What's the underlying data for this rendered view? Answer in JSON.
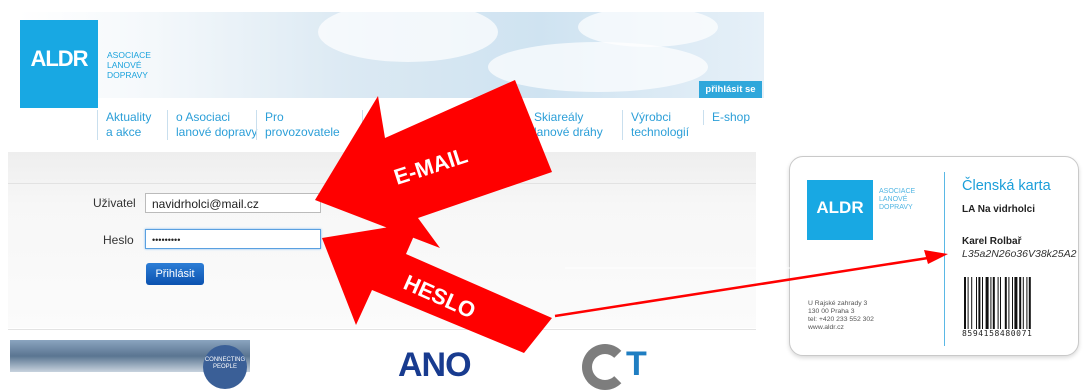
{
  "header": {
    "logo_text": "ALDR",
    "logo_sub": [
      "ASOCIACE",
      "LANOVÉ",
      "DOPRAVY"
    ],
    "login_link": "přihlásit se"
  },
  "nav": [
    {
      "line1": "Aktuality",
      "line2": "a akce"
    },
    {
      "line1": "o Asociaci",
      "line2": "lanové dopravy"
    },
    {
      "line1": "Pro",
      "line2": "provozovatele"
    },
    {
      "line1": "Skiareály",
      "line2": "lanové dráhy"
    },
    {
      "line1": "Výrobci",
      "line2": "technologií"
    },
    {
      "line1": "E-shop",
      "line2": ""
    }
  ],
  "login": {
    "user_label": "Uživatel",
    "user_value": "navidrholci@mail.cz",
    "password_label": "Heslo",
    "password_value": "•••••••••",
    "submit_label": "Přihlásit"
  },
  "bottom": {
    "badge_text": "CONNECTING PEOPLE",
    "ano_text": "ANO",
    "cot_text": "T"
  },
  "annotations": {
    "email_label": "E-MAIL",
    "password_label": "HESLO",
    "arrow_color": "#ff0000"
  },
  "card": {
    "logo_text": "ALDR",
    "logo_sub": [
      "ASOCIACE",
      "LANOVÉ",
      "DOPRAVY"
    ],
    "title": "Členská karta",
    "club": "LA Na vidrholci",
    "name": "Karel Rolbař",
    "code": "L35a2N26o36V38k25A2",
    "address": [
      "U Rajské zahrady 3",
      "130 00 Praha 3",
      "tel: +420 233 552 302",
      "www.aldr.cz"
    ],
    "barcode_number": "8594158480071"
  }
}
